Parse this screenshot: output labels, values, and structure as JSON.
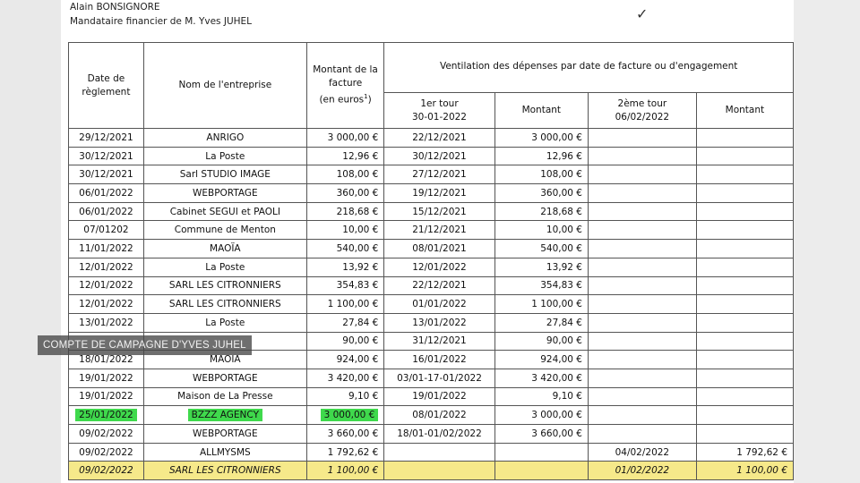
{
  "header": {
    "line1": "Alain BONSIGNORE",
    "line2": "Mandataire financier de M. Yves JUHEL",
    "mark": "✓"
  },
  "table": {
    "col_date": "Date de règlement",
    "col_company": "Nom de l'entreprise",
    "col_amount_line1": "Montant de la facture",
    "col_amount_line2": "(en euros",
    "col_amount_sup": "1",
    "col_amount_close": ")",
    "col_group": "Ventilation des dépenses par date de facture ou d'engagement",
    "tour1": "1er tour",
    "tour1_date": "30-01-2022",
    "montant1": "Montant",
    "tour2": "2ème tour",
    "tour2_date": "06/02/2022",
    "montant2": "Montant",
    "rows": [
      {
        "date": "29/12/2021",
        "company": "ANRIGO",
        "amount": "3 000,00 €",
        "d1": "22/12/2021",
        "m1": "3 000,00 €",
        "d2": "",
        "m2": ""
      },
      {
        "date": "30/12/2021",
        "company": "La Poste",
        "amount": "12,96 €",
        "d1": "30/12/2021",
        "m1": "12,96 €",
        "d2": "",
        "m2": ""
      },
      {
        "date": "30/12/2021",
        "company": "Sarl STUDIO IMAGE",
        "amount": "108,00 €",
        "d1": "27/12/2021",
        "m1": "108,00 €",
        "d2": "",
        "m2": ""
      },
      {
        "date": "06/01/2022",
        "company": "WEBPORTAGE",
        "amount": "360,00 €",
        "d1": "19/12/2021",
        "m1": "360,00 €",
        "d2": "",
        "m2": ""
      },
      {
        "date": "06/01/2022",
        "company": "Cabinet SEGUI et PAOLI",
        "amount": "218,68 €",
        "d1": "15/12/2021",
        "m1": "218,68 €",
        "d2": "",
        "m2": ""
      },
      {
        "date": "07/01202",
        "company": "Commune de Menton",
        "amount": "10,00 €",
        "d1": "21/12/2021",
        "m1": "10,00 €",
        "d2": "",
        "m2": ""
      },
      {
        "date": "11/01/2022",
        "company": "MAOÏA",
        "amount": "540,00 €",
        "d1": "08/01/2021",
        "m1": "540,00 €",
        "d2": "",
        "m2": ""
      },
      {
        "date": "12/01/2022",
        "company": "La Poste",
        "amount": "13,92 €",
        "d1": "12/01/2022",
        "m1": "13,92 €",
        "d2": "",
        "m2": ""
      },
      {
        "date": "12/01/2022",
        "company": "SARL LES CITRONNIERS",
        "amount": "354,83 €",
        "d1": "22/12/2021",
        "m1": "354,83 €",
        "d2": "",
        "m2": ""
      },
      {
        "date": "12/01/2022",
        "company": "SARL LES CITRONNIERS",
        "amount": "1 100,00 €",
        "d1": "01/01/2022",
        "m1": "1 100,00 €",
        "d2": "",
        "m2": ""
      },
      {
        "date": "13/01/2022",
        "company": "La Poste",
        "amount": "27,84 €",
        "d1": "13/01/2022",
        "m1": "27,84 €",
        "d2": "",
        "m2": ""
      },
      {
        "date": "",
        "company": "",
        "amount": "90,00 €",
        "d1": "31/12/2021",
        "m1": "90,00 €",
        "d2": "",
        "m2": ""
      },
      {
        "date": "18/01/2022",
        "company": "MAOIA",
        "amount": "924,00 €",
        "d1": "16/01/2022",
        "m1": "924,00 €",
        "d2": "",
        "m2": ""
      },
      {
        "date": "19/01/2022",
        "company": "WEBPORTAGE",
        "amount": "3 420,00 €",
        "d1": "03/01-17-01/2022",
        "m1": "3 420,00 €",
        "d2": "",
        "m2": ""
      },
      {
        "date": "19/01/2022",
        "company": "Maison de La Presse",
        "amount": "9,10 €",
        "d1": "19/01/2022",
        "m1": "9,10 €",
        "d2": "",
        "m2": ""
      },
      {
        "date": "25/01/2022",
        "company": "BZZZ AGENCY",
        "amount": "3 000,00 €",
        "d1": "08/01/2022",
        "m1": "3 000,00 €",
        "d2": "",
        "m2": ""
      },
      {
        "date": "09/02/2022",
        "company": "WEBPORTAGE",
        "amount": "3 660,00 €",
        "d1": "18/01-01/02/2022",
        "m1": "3 660,00 €",
        "d2": "",
        "m2": ""
      },
      {
        "date": "09/02/2022",
        "company": "ALLMYSMS",
        "amount": "1 792,62 €",
        "d1": "",
        "m1": "",
        "d2": "04/02/2022",
        "m2": "1 792,62 €"
      },
      {
        "date": "09/02/2022",
        "company": "SARL LES CITRONNIERS",
        "amount": "1 100,00 €",
        "d1": "",
        "m1": "",
        "d2": "01/02/2022",
        "m2": "1 100,00 €"
      }
    ]
  },
  "caption": "COMPTE DE CAMPAGNE D'YVES JUHEL",
  "colors": {
    "highlight_green": "#3fd94c",
    "highlight_yellow": "#f6e98a",
    "caption_bg": "#464646"
  }
}
